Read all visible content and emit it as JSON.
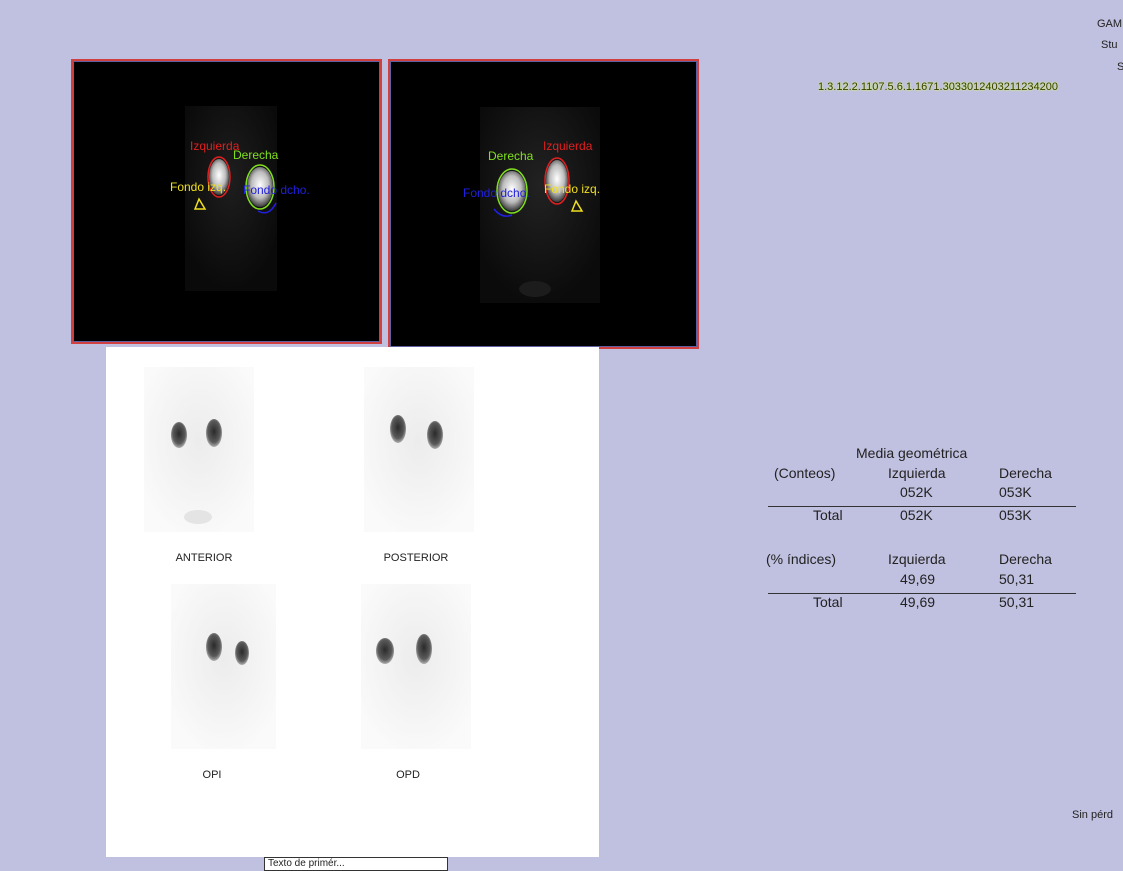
{
  "header": {
    "line1": "GAM",
    "line2": "Stu",
    "line3": "S",
    "uid": "1.3.12.2.1107.5.6.1.1671.3033012403211234200"
  },
  "panels": {
    "left": {
      "roi_left": "Izquierda",
      "roi_right": "Derecha",
      "bg_left": "Fondo izq.",
      "bg_right": "Fondo dcho."
    },
    "right": {
      "roi_right": "Derecha",
      "roi_left": "Izquierda",
      "bg_right": "Fondo dcho.",
      "bg_left": "Fondo izq."
    }
  },
  "roi_colors": {
    "left": "#e02020",
    "right": "#80e020",
    "bg_left": "#f0e020",
    "bg_right": "#2020e0"
  },
  "views": {
    "anterior": "ANTERIOR",
    "posterior": "POSTERIOR",
    "opi": "OPI",
    "opd": "OPD"
  },
  "results": {
    "title": "Media geométrica",
    "counts": {
      "label": "(Conteos)",
      "col_left": "Izquierda",
      "col_right": "Derecha",
      "left_value": "052K",
      "right_value": "053K",
      "total_label": "Total",
      "total_left": "052K",
      "total_right": "053K"
    },
    "indices": {
      "label": "(% índices)",
      "col_left": "Izquierda",
      "col_right": "Derecha",
      "left_value": "49,69",
      "right_value": "50,31",
      "total_label": "Total",
      "total_left": "49,69",
      "total_right": "50,31"
    }
  },
  "footer": {
    "note": "Sin pérd"
  },
  "tooltip": {
    "text": "Texto de primér..."
  }
}
